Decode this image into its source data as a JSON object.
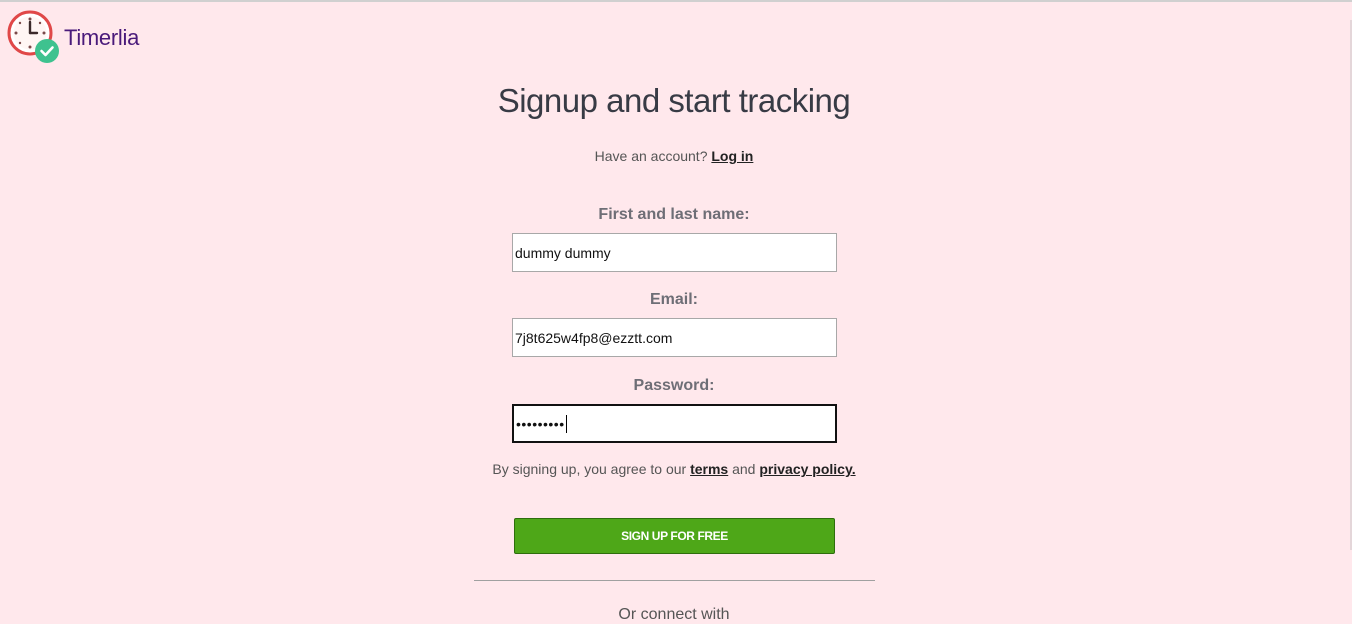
{
  "brand": {
    "name": "Timerlia",
    "logo_icon": "clock-check-icon",
    "text_color": "#4a1a7a"
  },
  "page": {
    "title": "Signup and start tracking",
    "background": "#ffe8ec"
  },
  "account_prompt": {
    "text": "Have an account?",
    "login_link": "Log in"
  },
  "form": {
    "name": {
      "label": "First and last name:",
      "value": "dummy dummy"
    },
    "email": {
      "label": "Email:",
      "value": "7j8t625w4fp8@ezztt.com"
    },
    "password": {
      "label": "Password:",
      "masked_value": "•••••••••"
    }
  },
  "terms": {
    "prefix": "By signing up, you agree to our",
    "terms_link": "terms",
    "and": "and",
    "privacy_link": "privacy policy."
  },
  "signup_button": {
    "label": "SIGN UP FOR FREE",
    "color": "#4ea718"
  },
  "bottom_partial": "Or connect with"
}
